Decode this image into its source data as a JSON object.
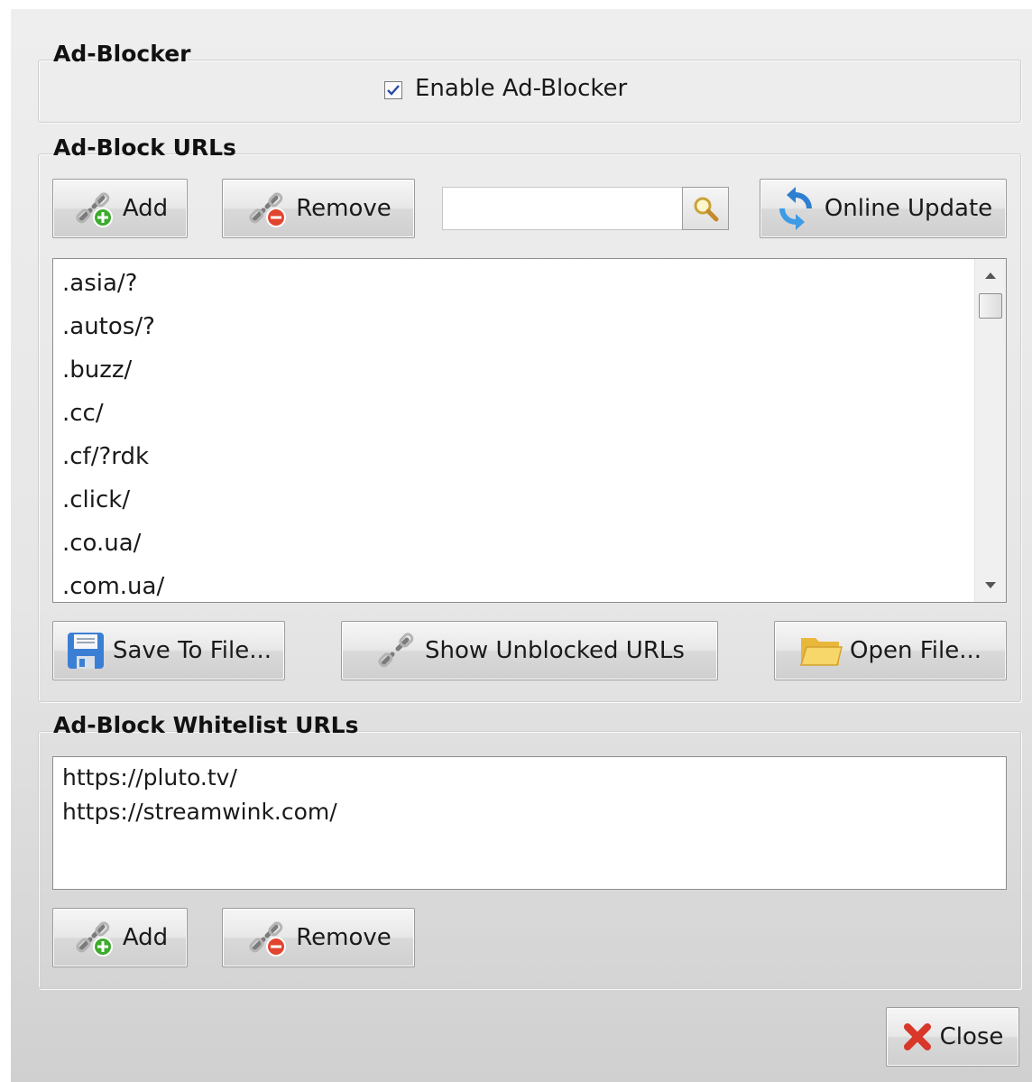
{
  "adblocker": {
    "group_title": "Ad-Blocker",
    "enable_label": "Enable Ad-Blocker",
    "enabled": true
  },
  "urls": {
    "group_title": "Ad-Block URLs",
    "add_label": "Add",
    "remove_label": "Remove",
    "search_value": "",
    "online_update_label": "Online Update",
    "items": [
      ".asia/?",
      ".autos/?",
      ".buzz/",
      ".cc/",
      ".cf/?rdk",
      ".click/",
      ".co.ua/",
      ".com.ua/"
    ],
    "save_label": "Save To File...",
    "show_unblocked_label": "Show Unblocked URLs",
    "open_label": "Open File..."
  },
  "whitelist": {
    "group_title": "Ad-Block Whitelist URLs",
    "items": [
      "https://pluto.tv/",
      "https://streamwink.com/"
    ],
    "add_label": "Add",
    "remove_label": "Remove"
  },
  "footer": {
    "close_label": "Close"
  },
  "icons": {
    "add": "link-add-icon",
    "remove": "link-remove-icon",
    "search": "magnifier-icon",
    "update": "refresh-icon",
    "save": "floppy-icon",
    "unblocked": "link-icon",
    "open": "folder-icon",
    "close": "close-x-icon"
  },
  "colors": {
    "add_badge": "#3cab2c",
    "remove_badge": "#e2452f",
    "close_x": "#d8372a",
    "update_icon": "#2e7fd0"
  }
}
